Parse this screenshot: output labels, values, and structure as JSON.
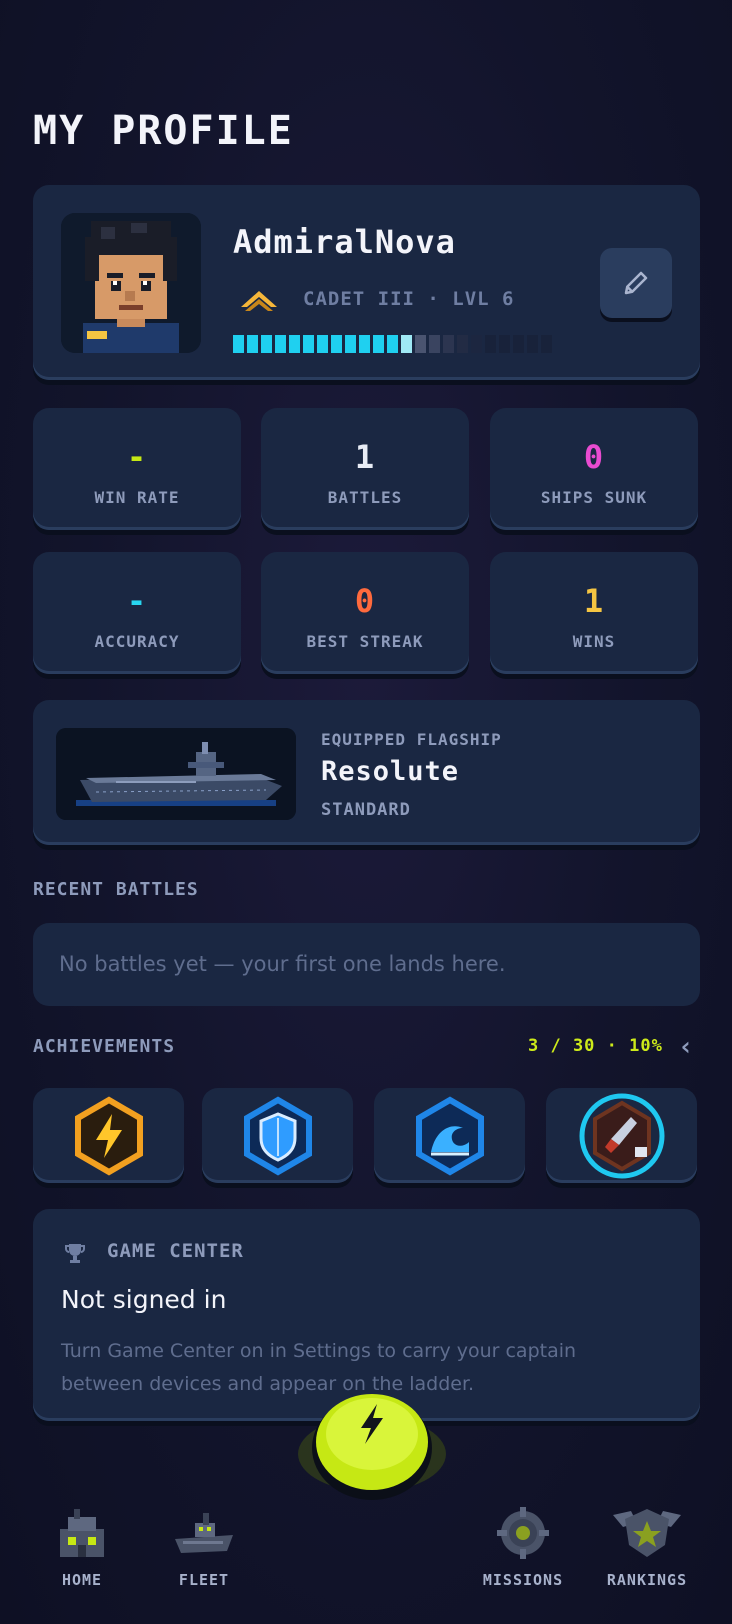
{
  "page": {
    "title": "MY PROFILE"
  },
  "profile": {
    "username": "AdmiralNova",
    "rank": "CADET III · LVL 6",
    "xp_progress": 0.5,
    "edit_icon": "pencil-icon"
  },
  "stats": [
    {
      "value": "-",
      "label": "WIN RATE",
      "color": "#c6e814"
    },
    {
      "value": "1",
      "label": "BATTLES",
      "color": "#e8ecf5"
    },
    {
      "value": "0",
      "label": "SHIPS SUNK",
      "color": "#e94bd0"
    },
    {
      "value": "-",
      "label": "ACCURACY",
      "color": "#28d6f0"
    },
    {
      "value": "0",
      "label": "BEST STREAK",
      "color": "#ff6a3d"
    },
    {
      "value": "1",
      "label": "WINS",
      "color": "#f5c542"
    }
  ],
  "flagship": {
    "caption": "EQUIPPED FLAGSHIP",
    "name": "Resolute",
    "tier": "STANDARD"
  },
  "recent_battles": {
    "title": "RECENT BATTLES",
    "empty": "No battles yet — your first one lands here."
  },
  "achievements": {
    "title": "ACHIEVEMENTS",
    "progress": "3 / 30 · 10%",
    "badges": [
      "lightning-badge-icon",
      "shield-badge-icon",
      "wave-badge-icon",
      "rocket-badge-icon"
    ]
  },
  "game_center": {
    "title": "GAME CENTER",
    "status": "Not signed in",
    "description": "Turn Game Center on in Settings to carry your captain between devices and appear on the ladder."
  },
  "nav": [
    {
      "label": "HOME",
      "icon": "home-icon"
    },
    {
      "label": "FLEET",
      "icon": "fleet-icon"
    },
    {
      "label": "MISSIONS",
      "icon": "missions-icon"
    },
    {
      "label": "RANKINGS",
      "icon": "rankings-icon"
    }
  ],
  "colors": {
    "accent": "#c6e814",
    "xp": "#1fd0f0",
    "card": "#1a2742"
  }
}
